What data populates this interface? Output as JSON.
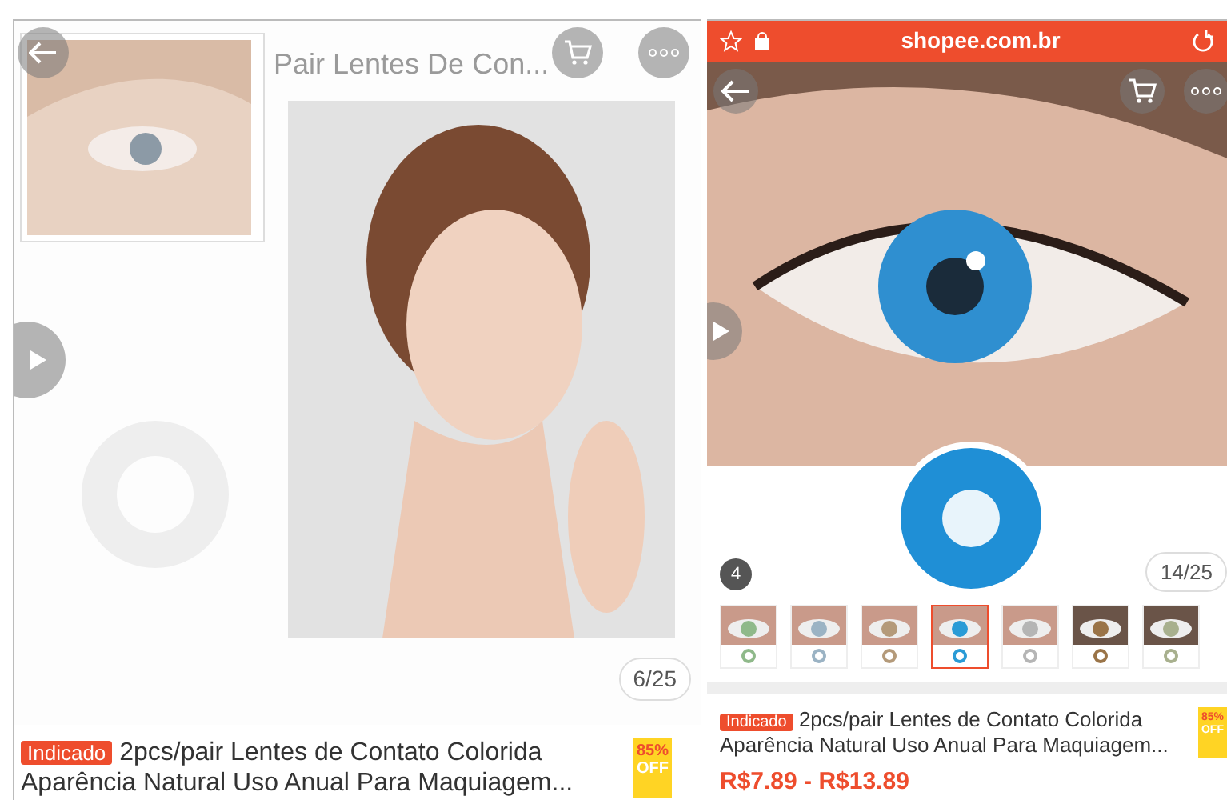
{
  "left_screen": {
    "top_bar": {
      "title": "Pair Lentes De Con..."
    },
    "gallery": {
      "counter": "6/25"
    },
    "product": {
      "badge": "Indicado",
      "title": "2pcs/pair Lentes de Contato Colorida Aparência Natural Uso Anual Para Maquiagem...",
      "discount": "85%",
      "discount_label": "OFF"
    }
  },
  "right_screen": {
    "browser_bar": {
      "url": "shopee.com.br"
    },
    "gallery": {
      "index": "4",
      "counter": "14/25"
    },
    "variants": [
      {
        "color": "#8fb98a",
        "selected": false
      },
      {
        "color": "#9bb3c4",
        "selected": false
      },
      {
        "color": "#b49a7a",
        "selected": false
      },
      {
        "color": "#2a9bd6",
        "selected": true
      },
      {
        "color": "#b5b5b5",
        "selected": false
      },
      {
        "color": "#9a7448",
        "selected": false
      },
      {
        "color": "#a8b08e",
        "selected": false
      }
    ],
    "product": {
      "badge": "Indicado",
      "title": "2pcs/pair Lentes de Contato Colorida Aparência Natural Uso Anual Para Maquiagem...",
      "discount": "85%",
      "discount_label": "OFF",
      "price": "R$7.89 - R$13.89"
    }
  }
}
